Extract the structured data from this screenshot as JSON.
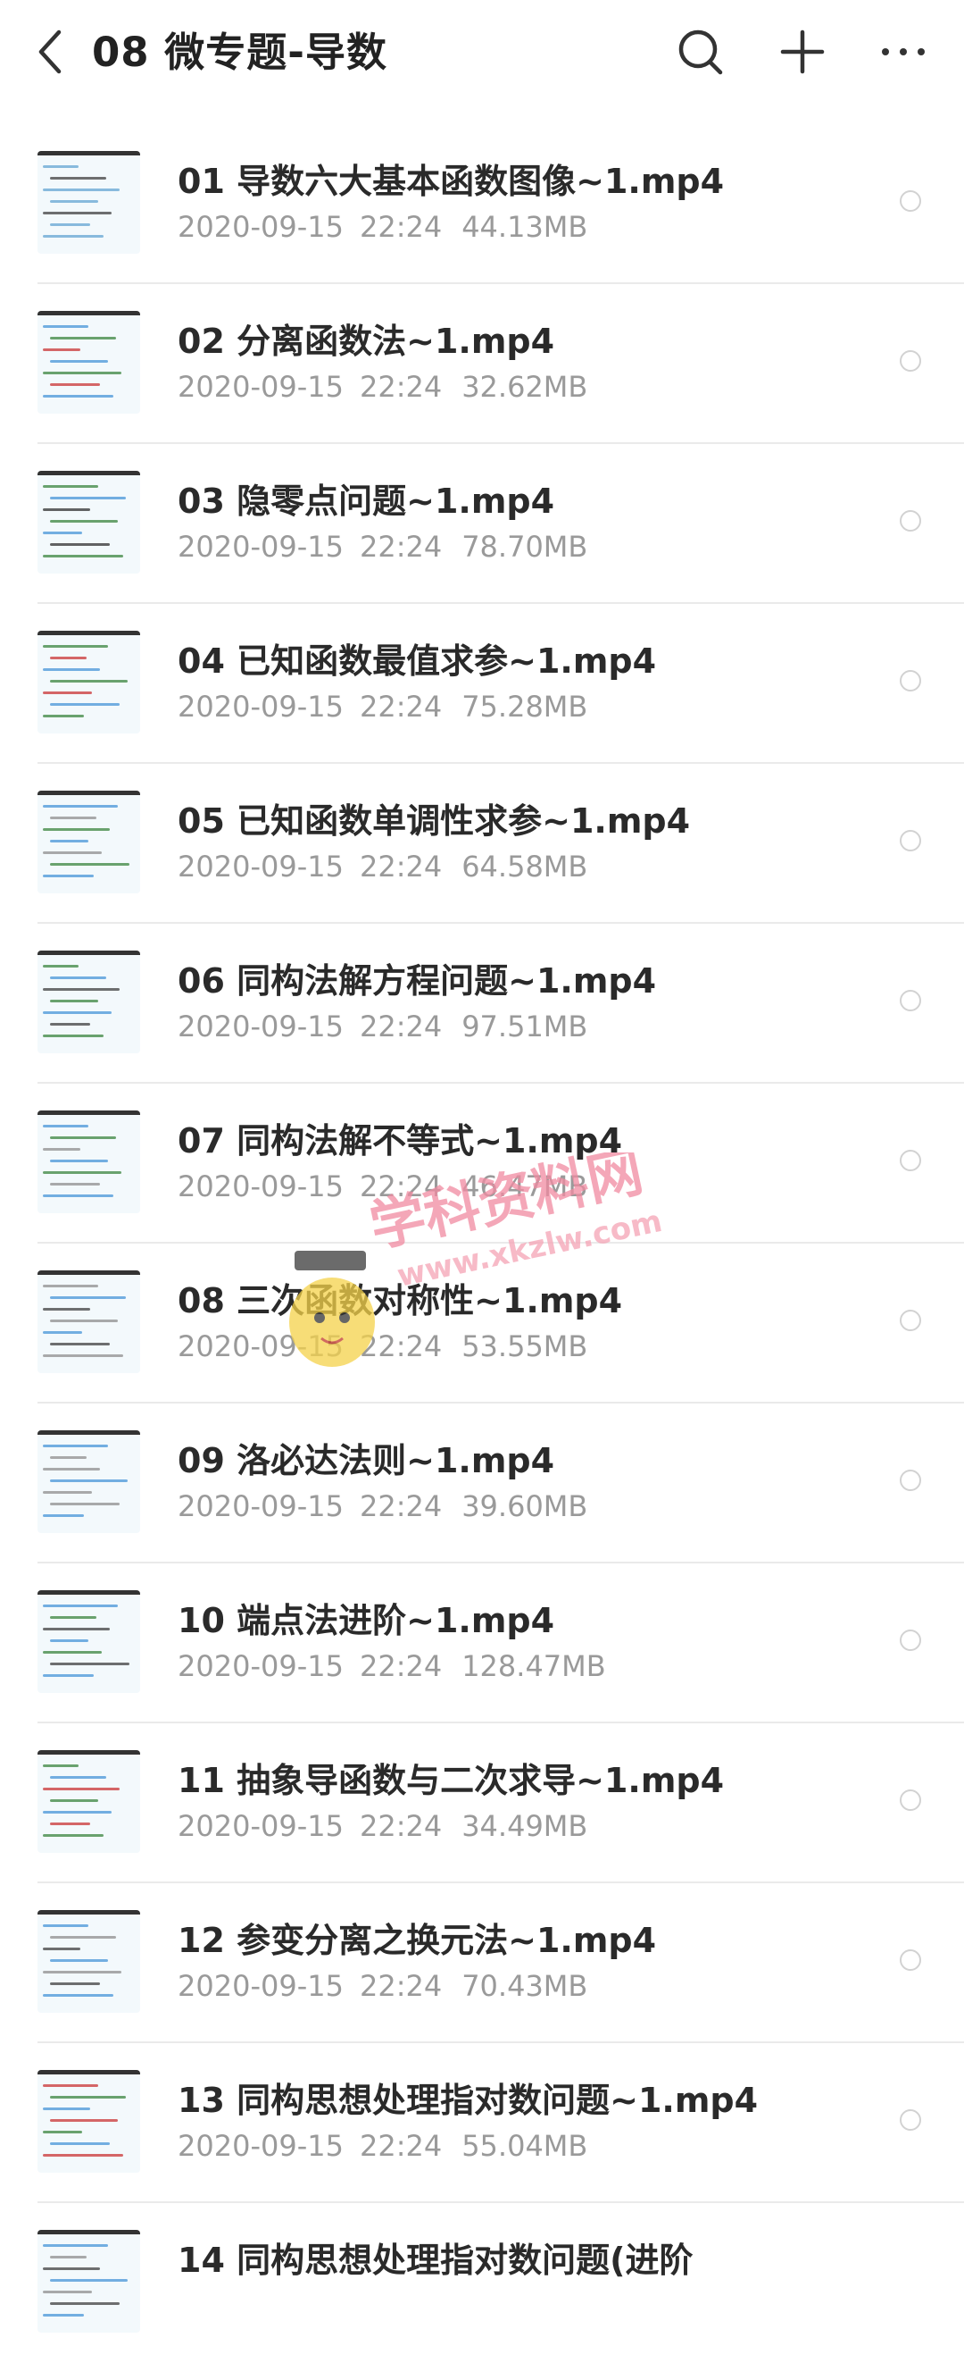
{
  "header": {
    "title": "08 微专题-导数",
    "back_icon": "chevron-left-icon",
    "search_icon": "search-icon",
    "add_icon": "plus-icon",
    "more_icon": "more-horizontal-icon"
  },
  "files": [
    {
      "name": "01 导数六大基本函数图像~1.mp4",
      "date": "2020-09-15",
      "time": "22:24",
      "size": "44.13MB"
    },
    {
      "name": "02 分离函数法~1.mp4",
      "date": "2020-09-15",
      "time": "22:24",
      "size": "32.62MB"
    },
    {
      "name": "03 隐零点问题~1.mp4",
      "date": "2020-09-15",
      "time": "22:24",
      "size": "78.70MB"
    },
    {
      "name": "04 已知函数最值求参~1.mp4",
      "date": "2020-09-15",
      "time": "22:24",
      "size": "75.28MB"
    },
    {
      "name": "05 已知函数单调性求参~1.mp4",
      "date": "2020-09-15",
      "time": "22:24",
      "size": "64.58MB"
    },
    {
      "name": "06 同构法解方程问题~1.mp4",
      "date": "2020-09-15",
      "time": "22:24",
      "size": "97.51MB"
    },
    {
      "name": "07 同构法解不等式~1.mp4",
      "date": "2020-09-15",
      "time": "22:24",
      "size": "46.47MB"
    },
    {
      "name": "08 三次函数对称性~1.mp4",
      "date": "2020-09-15",
      "time": "22:24",
      "size": "53.55MB"
    },
    {
      "name": "09 洛必达法则~1.mp4",
      "date": "2020-09-15",
      "time": "22:24",
      "size": "39.60MB"
    },
    {
      "name": "10 端点法进阶~1.mp4",
      "date": "2020-09-15",
      "time": "22:24",
      "size": "128.47MB"
    },
    {
      "name": "11 抽象导函数与二次求导~1.mp4",
      "date": "2020-09-15",
      "time": "22:24",
      "size": "34.49MB"
    },
    {
      "name": "12 参变分离之换元法~1.mp4",
      "date": "2020-09-15",
      "time": "22:24",
      "size": "70.43MB"
    },
    {
      "name": "13 同构思想处理指对数问题~1.mp4",
      "date": "2020-09-15",
      "time": "22:24",
      "size": "55.04MB"
    },
    {
      "name": "14 同构思想处理指对数问题(进阶",
      "date": "",
      "time": "",
      "size": ""
    }
  ],
  "watermark": {
    "main": "学科资料网",
    "url": "www.xkzlw.com"
  },
  "colors": {
    "title": "#222222",
    "meta": "#9a9a9a",
    "divider": "#eaeaea",
    "watermark": "#e86a8a"
  }
}
